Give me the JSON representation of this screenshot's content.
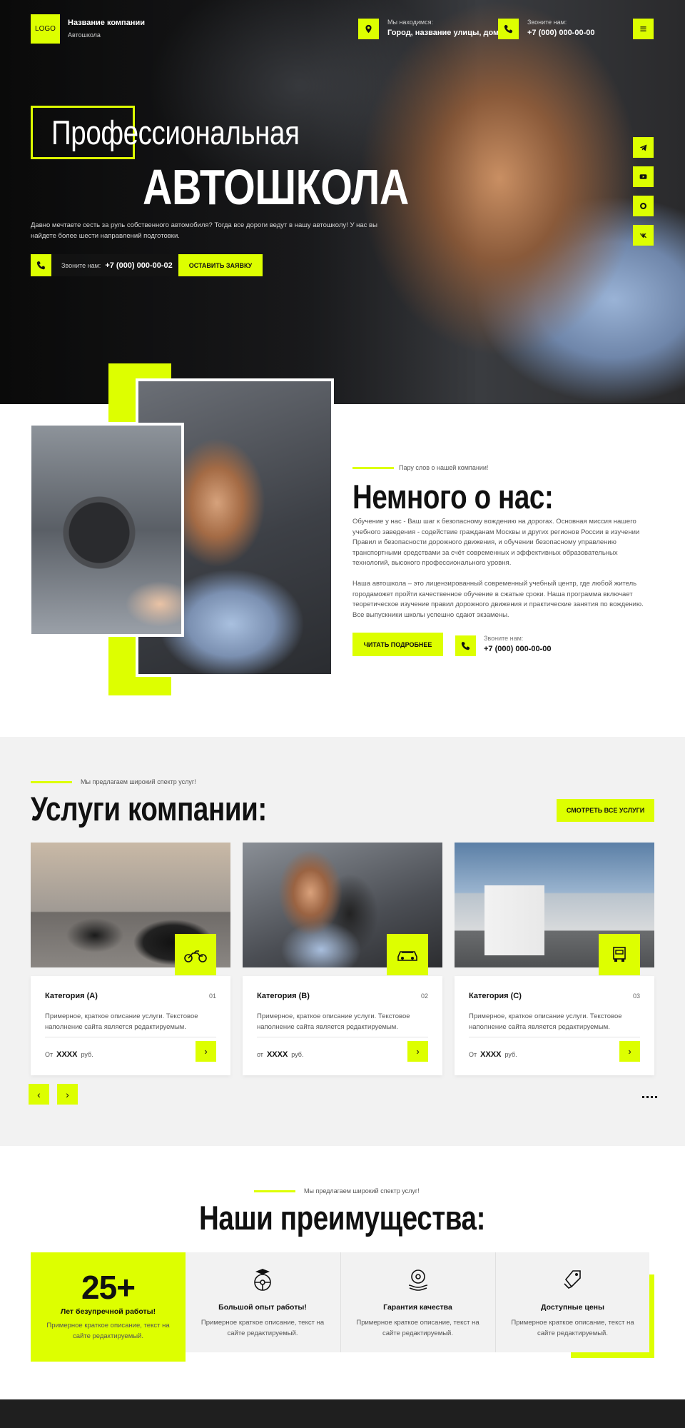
{
  "header": {
    "logo": "LOGO",
    "company_name": "Название компании",
    "company_sub": "Автошкола",
    "location_label": "Мы находимся:",
    "location_value": "Город, название улицы, дом",
    "phone_label": "Звоните нам:",
    "phone_value": "+7 (000) 000-00-00"
  },
  "hero": {
    "title_line1": "Профессиональная",
    "title_line2": "АВТОШКОЛА",
    "text": "Давно мечтаете сесть за руль собственного автомобиля? Тогда все дороги ведут в нашу автошколу! У нас вы найдете более шести направлений подготовки.",
    "phone_label": "Звоните нам:",
    "phone_value": "+7 (000) 000-00-02",
    "cta": "ОСТАВИТЬ ЗАЯВКУ",
    "social_icons": [
      "telegram-icon",
      "youtube-icon",
      "whatsapp-icon",
      "vk-icon"
    ]
  },
  "about": {
    "kicker": "Пару слов о нашей компании!",
    "title": "Немного о нас:",
    "p1": "Обучение у нас - Ваш шаг к безопасному вождению на дорогах. Основная миссия нашего учебного заведения - содействие гражданам Москвы и других регионов России в изучении Правил и безопасности дорожного движения, и обучении безопасному управлению транспортными средствами за счёт современных и эффективных образовательных технологий, высокого профессионального уровня.",
    "p2": "Наша автошкола – это лицензированный современный учебный центр, где любой житель городаможет пройти качественное обучение в сжатые сроки. Наша программа включает теоретическое изучение правил дорожного движения и практические занятия по вождению. Все выпускники школы успешно сдают экзамены.",
    "button": "ЧИТАТЬ ПОДРОБНЕЕ",
    "phone_label": "Звоните нам:",
    "phone_value": "+7 (000) 000-00-00"
  },
  "services": {
    "kicker": "Мы предлагаем широкий спектр услуг!",
    "title": "Услуги компании:",
    "all_button": "СМОТРЕТЬ ВСЕ УСЛУГИ",
    "cards": [
      {
        "name": "Категория (А)",
        "num": "01",
        "desc": "Примерное, краткое описание услуги. Текстовое наполнение сайта является редактируемым.",
        "price_prefix": "От",
        "price": "XXXX",
        "price_suffix": "руб.",
        "icon": "motorcycle-icon"
      },
      {
        "name": "Категория (В)",
        "num": "02",
        "desc": "Примерное, краткое описание услуги. Текстовое наполнение сайта является редактируемым.",
        "price_prefix": "от",
        "price": "XXXX",
        "price_suffix": "руб.",
        "icon": "car-icon"
      },
      {
        "name": "Категория (С)",
        "num": "03",
        "desc": "Примерное, краткое описание услуги. Текстовое наполнение сайта является редактируемым.",
        "price_prefix": "От",
        "price": "XXXX",
        "price_suffix": "руб.",
        "icon": "truck-icon"
      }
    ],
    "prev": "‹",
    "next": "›"
  },
  "advantages": {
    "kicker": "Мы предлагаем широкий спектр услуг!",
    "title": "Наши преимущества:",
    "highlight": {
      "number": "25+",
      "heading": "Лет безупречной работы!",
      "desc": "Примерное краткое описание, текст на сайте редактируемый."
    },
    "items": [
      {
        "heading": "Большой опыт работы!",
        "desc": "Примерное краткое описание, текст на сайте редактируемый.",
        "icon": "steering-graduate-icon"
      },
      {
        "heading": "Гарантия качества",
        "desc": "Примерное краткое описание, текст на сайте редактируемый.",
        "icon": "quality-wheel-icon"
      },
      {
        "heading": "Доступные цены",
        "desc": "Примерное краткое описание, текст на сайте редактируемый.",
        "icon": "price-tag-icon"
      }
    ]
  },
  "colors": {
    "accent": "#ddff00",
    "dark": "#111111",
    "section_bg": "#f2f2f2"
  }
}
